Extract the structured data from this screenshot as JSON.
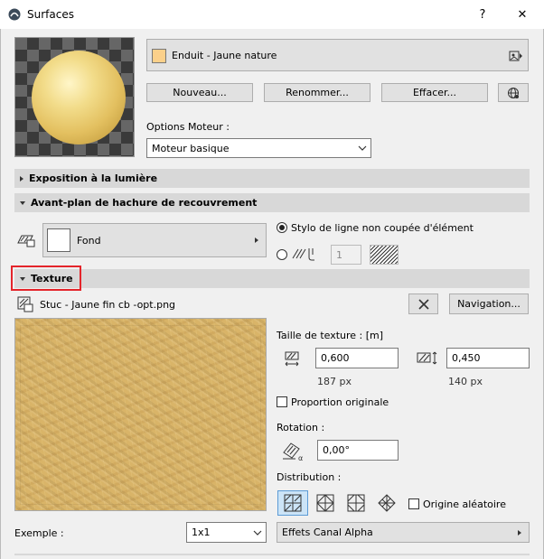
{
  "window": {
    "title": "Surfaces",
    "help_label": "?",
    "close_label": "✕"
  },
  "surface": {
    "name": "Enduit - Jaune nature",
    "color": "#fbd08a"
  },
  "buttons": {
    "new": "Nouveau...",
    "rename": "Renommer...",
    "delete": "Effacer...",
    "navigation": "Navigation..."
  },
  "engine": {
    "label": "Options Moteur :",
    "value": "Moteur basique"
  },
  "panels": {
    "exposure": "Exposition à la lumière",
    "cover_fill": "Avant-plan de hachure de recouvrement",
    "texture": "Texture"
  },
  "cover": {
    "fill_name": "Fond",
    "radio1_label": "Stylo de ligne non coupée d'élément",
    "pen_value": "1"
  },
  "texture": {
    "file": "Stuc - Jaune fin cb -opt.png",
    "size_label": "Taille de texture : [m]",
    "width": "0,600",
    "height": "0,450",
    "width_px": "187 px",
    "height_px": "140 px",
    "proportion_label": "Proportion originale",
    "rotation_label": "Rotation :",
    "rotation": "0,00°",
    "distribution_label": "Distribution :",
    "random_origin_label": "Origine aléatoire"
  },
  "example": {
    "label": "Exemple :",
    "value": "1x1"
  },
  "alpha": {
    "label": "Effets Canal Alpha"
  },
  "accent": "#e4252b"
}
